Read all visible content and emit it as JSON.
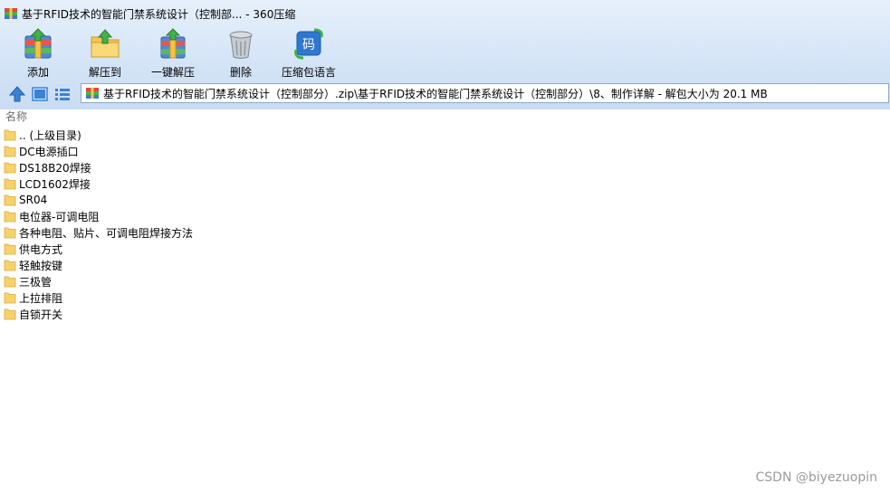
{
  "window": {
    "title": "基于RFID技术的智能门禁系统设计（控制部... - 360压缩"
  },
  "toolbar": {
    "buttons": [
      {
        "label": "添加",
        "icon": "add-archive-icon"
      },
      {
        "label": "解压到",
        "icon": "extract-to-icon"
      },
      {
        "label": "一键解压",
        "icon": "one-click-extract-icon"
      },
      {
        "label": "删除",
        "icon": "trash-icon"
      },
      {
        "label": "压缩包语言",
        "icon": "archive-language-icon"
      }
    ]
  },
  "address": {
    "path": "基于RFID技术的智能门禁系统设计（控制部分）.zip\\基于RFID技术的智能门禁系统设计（控制部分）\\8、制作详解 - 解包大小为 20.1 MB"
  },
  "list": {
    "column_name": "名称",
    "items": [
      ".. (上级目录)",
      "DC电源插口",
      "DS18B20焊接",
      "LCD1602焊接",
      "SR04",
      "电位器-可调电阻",
      "各种电阻、贴片、可调电阻焊接方法",
      "供电方式",
      "轻触按键",
      "三极管",
      "上拉排阻",
      "自锁开关"
    ]
  },
  "watermark": "CSDN @biyezuopin",
  "colors": {
    "folder": "#f7d26c",
    "folder_edge": "#d9a93a",
    "chrome_top": "#e6f0fb",
    "chrome_bottom": "#c9dcf3",
    "nav_blue": "#3b82d6"
  }
}
